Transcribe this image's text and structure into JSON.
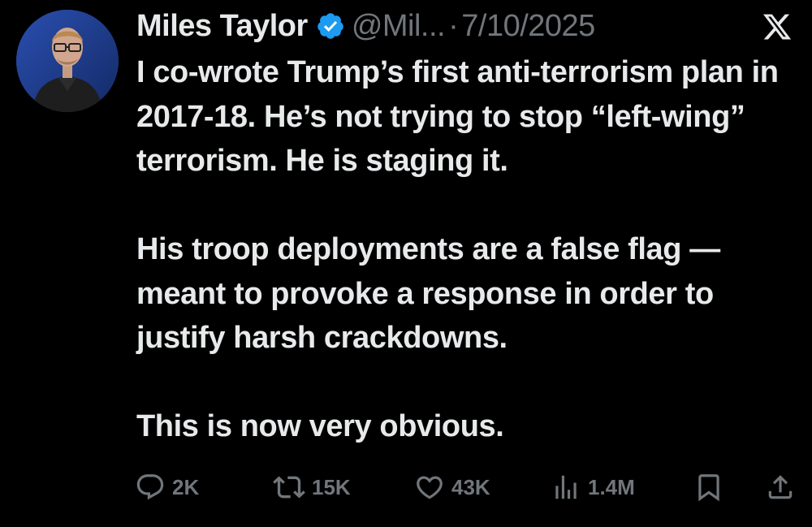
{
  "author": {
    "display_name": "Miles Taylor",
    "handle": "@Mil...",
    "verified": true,
    "avatar_icon": "profile-photo"
  },
  "meta": {
    "separator": "·",
    "date": "7/10/2025",
    "platform_icon": "x-logo"
  },
  "body": {
    "paragraphs": [
      "I co-wrote Trump’s first anti-terrorism plan in 2017-18. He’s not trying to stop “left-wing” terrorism. He is staging it.",
      "His troop deployments are a false flag — meant to provoke a response in order to justify harsh crackdowns.",
      "This is now very obvious."
    ]
  },
  "actions": {
    "replies": "2K",
    "reposts": "15K",
    "likes": "43K",
    "views": "1.4M",
    "bookmark_icon": "bookmark-icon",
    "share_icon": "share-icon"
  },
  "colors": {
    "background": "#000000",
    "text_primary": "#e7e9ea",
    "text_secondary": "#71767b",
    "verified_blue": "#1d9bf0"
  }
}
